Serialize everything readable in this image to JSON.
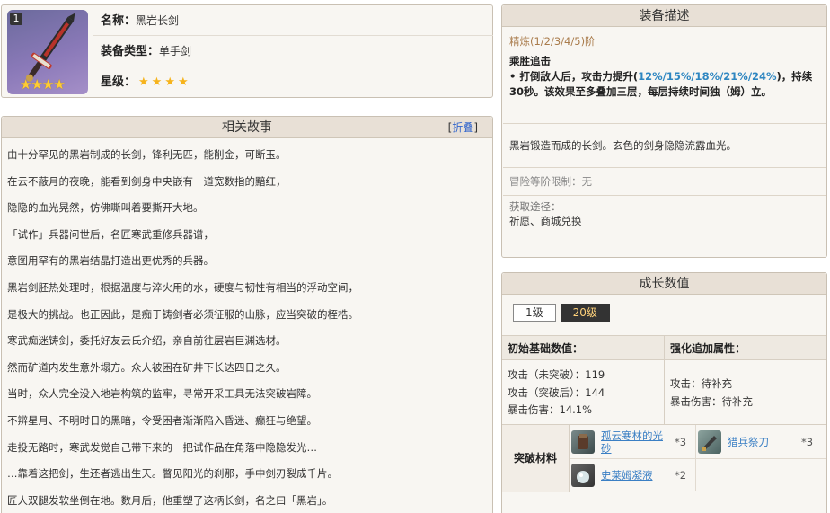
{
  "info": {
    "level_badge": "1",
    "stars": "★★★★",
    "name_label": "名称：",
    "name": "黑岩长剑",
    "type_label": "装备类型：",
    "type": "单手剑",
    "rarity_label": "星级：",
    "rarity_stars": [
      "★",
      "★",
      "★",
      "★"
    ]
  },
  "story": {
    "title": "相关故事",
    "fold_open": "[",
    "fold_label": "折叠",
    "fold_close": "]",
    "lines": [
      "由十分罕见的黑岩制成的长剑，锋利无匹，能削金，可断玉。",
      "在云不蔽月的夜晚，能看到剑身中央嵌有一道宽数指的黯红，",
      "隐隐的血光晃然，仿佛嘶叫着要撕开大地。",
      "「试作」兵器问世后，名匠寒武重修兵器谱，",
      "意图用罕有的黑岩结晶打造出更优秀的兵器。",
      "黑岩剑胚热处理时，根据温度与淬火用的水，硬度与韧性有相当的浮动空间，",
      "是极大的挑战。也正因此，是痴于铸剑者必须征服的山脉，应当突破的桎梏。",
      "寒武痴迷铸剑，委托好友云氏介绍，亲自前往层岩巨渊选材。",
      "然而矿道内发生意外塌方。众人被困在矿井下长达四日之久。",
      "当时，众人完全没入地岩构筑的监牢，寻常开采工具无法突破岩障。",
      "不辨星月、不明时日的黑暗，令受困者渐渐陷入昏迷、癫狂与绝望。",
      "走投无路时，寒武发觉自己带下来的一把试作品在角落中隐隐发光…",
      "…靠着这把剑，生还者逃出生天。瞥见阳光的刹那，手中剑刃裂成千片。",
      "匠人双腿发软坐倒在地。数月后，他重塑了这柄长剑，名之曰「黑岩」。"
    ]
  },
  "desc": {
    "title": "装备描述",
    "refine": "精炼(1/2/3/4/5)阶",
    "skill_name": "乘胜追击",
    "skill_pre": "• 打倒敌人后，攻击力提升(",
    "skill_values": "12%/15%/18%/21%/24%",
    "skill_post": ")，持续30秒。该效果至多叠加三层，每层持续时间独（姆）立。",
    "flavor": "黑岩锻造而成的长剑。玄色的剑身隐隐流露血光。",
    "limit": "冒险等阶限制：无",
    "obtain_label": "获取途径：",
    "obtain_value": "祈愿、商城兑换"
  },
  "growth": {
    "title": "成长数值",
    "levels": [
      "1级",
      "20级"
    ],
    "base_header": "初始基础数值：",
    "bonus_header": "强化追加属性：",
    "base_stats": [
      "攻击（未突破）：119",
      "攻击（突破后）：144",
      "暴击伤害：14.1%"
    ],
    "bonus_stats": [
      "攻击：待补充",
      "暴击伤害：待补充"
    ],
    "materials_label": "突破材料",
    "materials": [
      {
        "name": "孤云寒林的光砂",
        "qty": "*3"
      },
      {
        "name": "猎兵祭刀",
        "qty": "*3"
      },
      {
        "name": "史莱姆凝液",
        "qty": "*2"
      }
    ]
  }
}
